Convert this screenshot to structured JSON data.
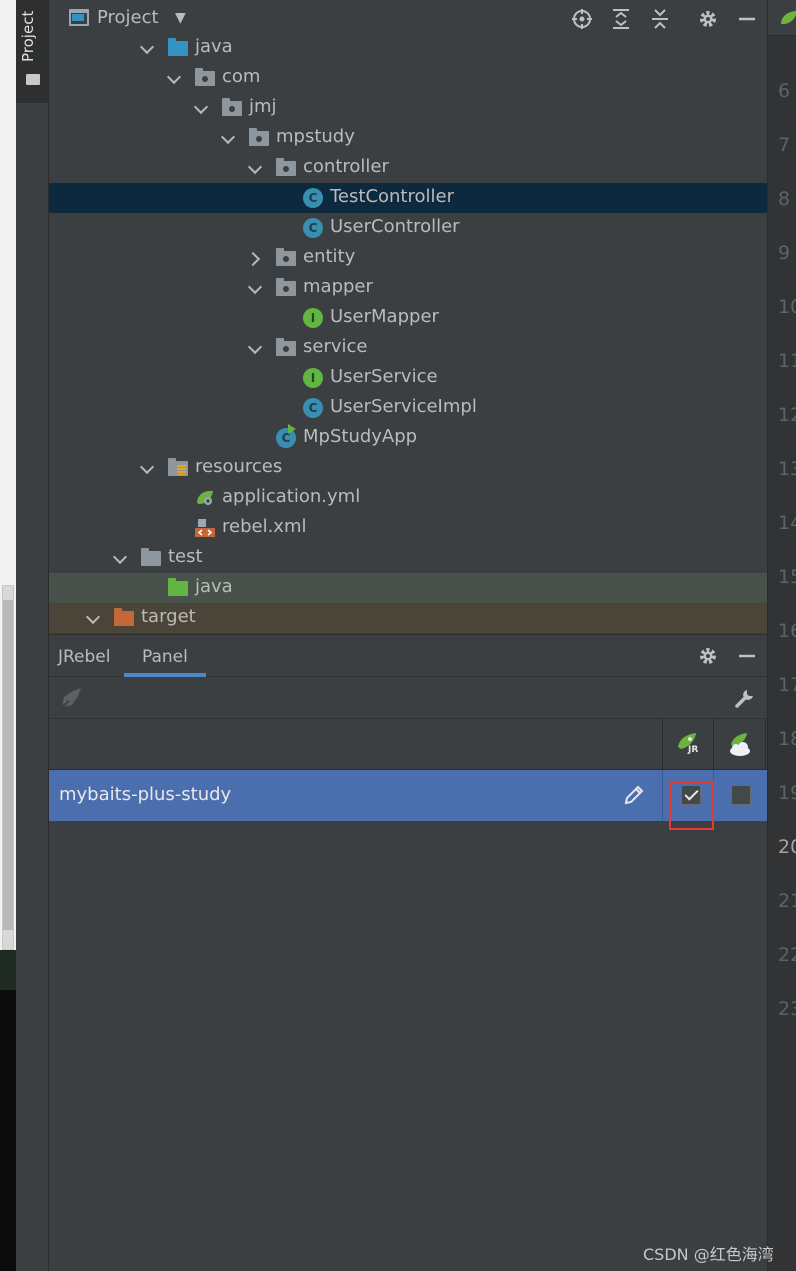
{
  "project_panel": {
    "title": "Project",
    "dropdown_glyph": "▼",
    "header_icons": [
      "locate-icon",
      "expand-all-icon",
      "collapse-all-icon",
      "gear-icon",
      "minimize-icon"
    ],
    "tree": [
      {
        "label": "java",
        "kind": "source-root",
        "expanded": true
      },
      {
        "label": "com",
        "kind": "package",
        "expanded": true
      },
      {
        "label": "jmj",
        "kind": "package",
        "expanded": true
      },
      {
        "label": "mpstudy",
        "kind": "package",
        "expanded": true
      },
      {
        "label": "controller",
        "kind": "package",
        "expanded": true
      },
      {
        "label": "TestController",
        "kind": "class",
        "selected": true
      },
      {
        "label": "UserController",
        "kind": "class"
      },
      {
        "label": "entity",
        "kind": "package",
        "expanded": false
      },
      {
        "label": "mapper",
        "kind": "package",
        "expanded": true
      },
      {
        "label": "UserMapper",
        "kind": "interface"
      },
      {
        "label": "service",
        "kind": "package",
        "expanded": true
      },
      {
        "label": "UserService",
        "kind": "interface"
      },
      {
        "label": "UserServiceImpl",
        "kind": "class"
      },
      {
        "label": "MpStudyApp",
        "kind": "spring-boot-app"
      },
      {
        "label": "resources",
        "kind": "resources-root",
        "expanded": true
      },
      {
        "label": "application.yml",
        "kind": "spring-config"
      },
      {
        "label": "rebel.xml",
        "kind": "xml"
      },
      {
        "label": "test",
        "kind": "folder",
        "expanded": true
      },
      {
        "label": "java",
        "kind": "test-root"
      },
      {
        "label": "target",
        "kind": "excluded-folder",
        "expanded": true
      }
    ]
  },
  "side_bar": {
    "project_tab_label": "Project"
  },
  "jrebel_panel": {
    "tabs": [
      "JRebel",
      "Panel"
    ],
    "active_tab": "Panel",
    "row_name": "mybaits-plus-study",
    "jrebel_checked": true,
    "remote_checked": false,
    "column_icon_jr_text": "JR",
    "colors": {
      "row_selected": "#4b6eaf",
      "highlight": "#e53935"
    }
  },
  "gutter": {
    "line_numbers": [
      "6",
      "7",
      "8",
      "9",
      "10",
      "11",
      "12",
      "13",
      "14",
      "15",
      "16",
      "17",
      "18",
      "19",
      "20",
      "21",
      "22",
      "23"
    ],
    "current_line": "20"
  },
  "watermark": "CSDN @红色海湾"
}
